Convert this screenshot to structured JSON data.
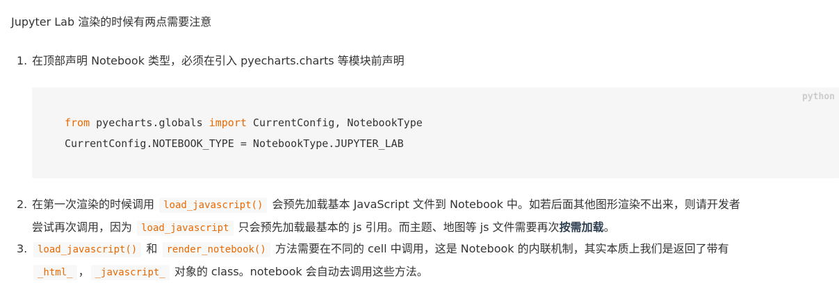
{
  "intro": "Jupyter Lab 渲染的时候有两点需要注意",
  "list": [
    {
      "num": "1.",
      "text": "在顶部声明 Notebook 类型，必须在引入 pyecharts.charts 等模块前声明"
    },
    {
      "num": "2.",
      "seg1": "在第一次渲染的时候调用",
      "code1": "load_javascript()",
      "seg2": "会预先加载基本 JavaScript 文件到 Notebook 中。如若后面其他图形渲染不出来，则请开发者",
      "seg3": "尝试再次调用，因为",
      "code2": "load_javascript",
      "seg4": "只会预先加载最基本的 js 引用。而主题、地图等 js 文件需要再次",
      "bold": "按需加载",
      "seg5": "。"
    },
    {
      "num": "3.",
      "code1": "load_javascript()",
      "seg1": "和",
      "code2": "render_notebook()",
      "seg2": "方法需要在不同的 cell 中调用，这是 Notebook 的内联机制，其实本质上我们是返回了带有",
      "code3": "_html_",
      "seg3": "，",
      "code4": "_javascript_",
      "seg4": "对象的 class。notebook 会自动去调用这些方法。"
    }
  ],
  "code_block": {
    "language": "python",
    "line1": {
      "kw1": "from",
      "mid": " pyecharts.globals ",
      "kw2": "import",
      "rest": " CurrentConfig, NotebookType"
    },
    "line2": "CurrentConfig.NOTEBOOK_TYPE = NotebookType.JUPYTER_LAB"
  },
  "colors": {
    "text": "#333333",
    "code_accent": "#e96900",
    "code_bg": "#f6f6f6",
    "inline_code_bg": "#f8f8f8",
    "lang_label": "#cccccc"
  }
}
